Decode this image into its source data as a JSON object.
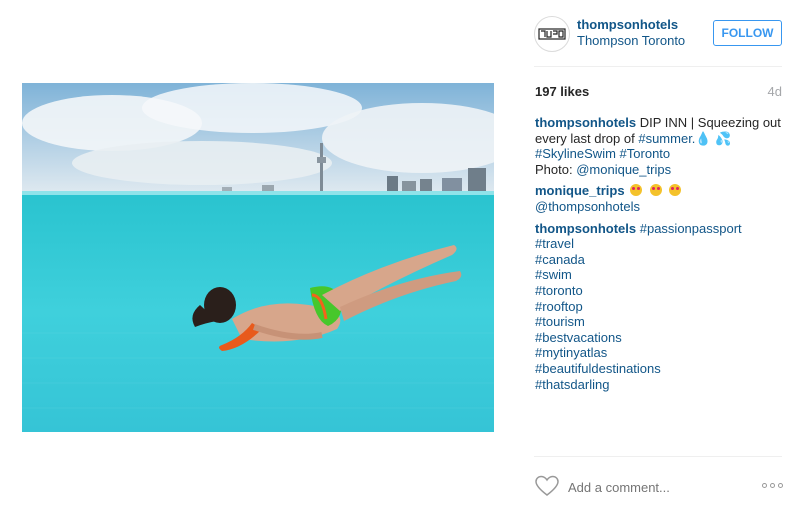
{
  "post": {
    "username": "thompsonhotels",
    "location": "Thompson Toronto",
    "follow_label": "FOLLOW",
    "likes": "197 likes",
    "age": "4d",
    "caption": {
      "user": "thompsonhotels",
      "text": "DIP INN | Squeezing out every last drop of",
      "tag1": "#summer.",
      "tag2": "#SkylineSwim",
      "tag3": "#Toronto",
      "photo_label": "Photo:",
      "photo_credit": "@monique_trips"
    },
    "comment2": {
      "user": "monique_trips",
      "mention": "@thompsonhotels"
    },
    "comment3": {
      "user": "thompsonhotels",
      "tags": [
        "#passionpassport",
        "#travel",
        "#canada",
        "#swim",
        "#toronto",
        "#rooftop",
        "#tourism",
        "#bestvacations",
        "#mytinyatlas",
        "#beautifuldestinations",
        "#thatsdarling"
      ]
    },
    "add_comment_placeholder": "Add a comment...",
    "icons": {
      "avatar_logo": "thompson-logo",
      "like": "heart-icon",
      "more": "more-options-icon"
    },
    "colors": {
      "link": "#125688",
      "follow": "#3897f0",
      "water": "#38c6d6"
    }
  }
}
